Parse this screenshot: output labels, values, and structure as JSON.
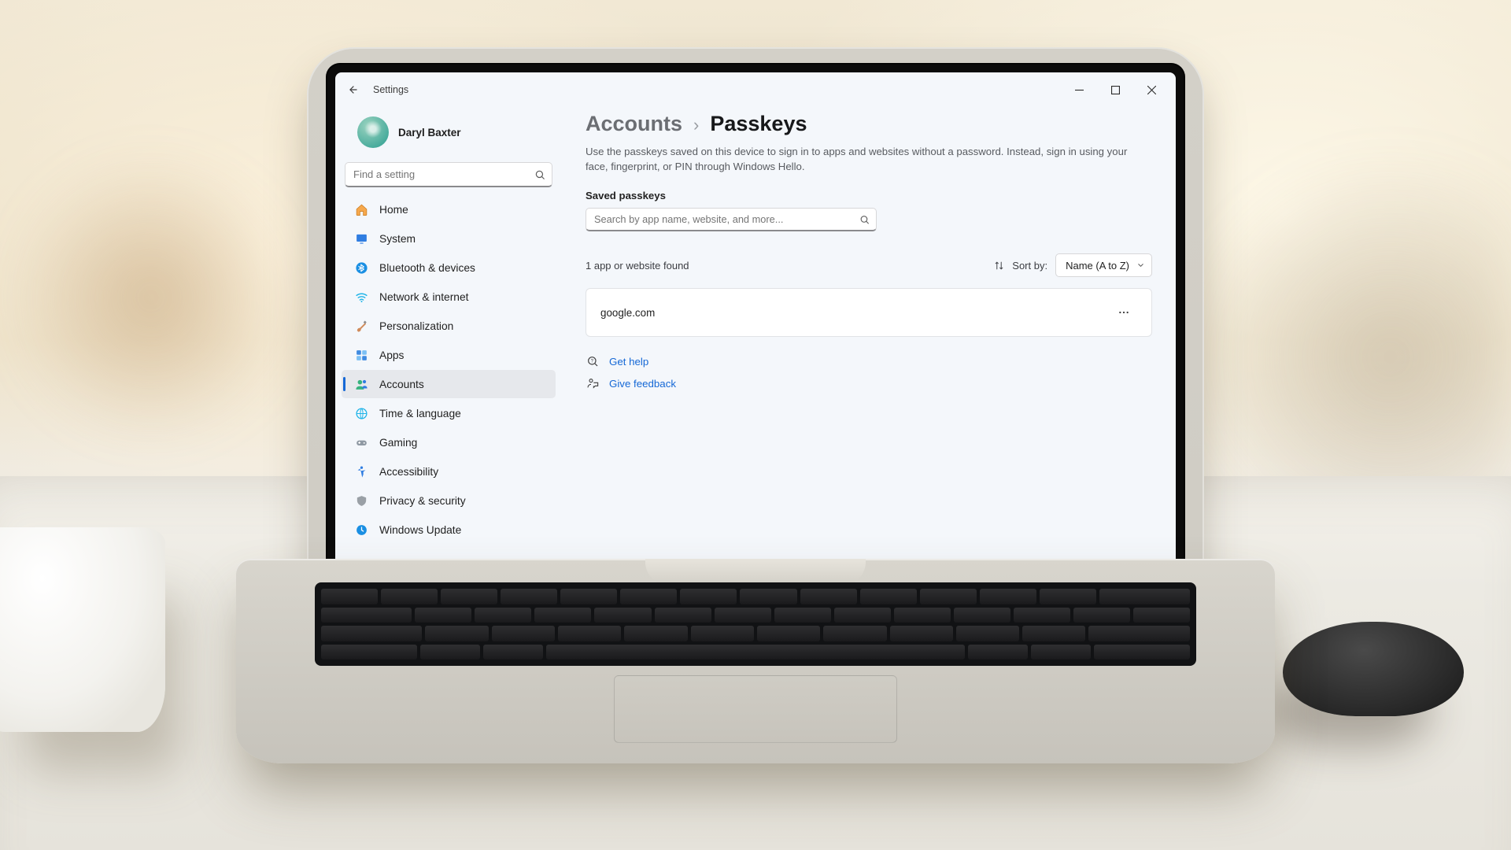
{
  "window": {
    "app_title": "Settings"
  },
  "profile": {
    "display_name": "Daryl Baxter"
  },
  "sidebar": {
    "search_placeholder": "Find a setting",
    "items": [
      {
        "id": "home",
        "label": "Home"
      },
      {
        "id": "system",
        "label": "System"
      },
      {
        "id": "bluetooth",
        "label": "Bluetooth & devices"
      },
      {
        "id": "network",
        "label": "Network & internet"
      },
      {
        "id": "personalization",
        "label": "Personalization"
      },
      {
        "id": "apps",
        "label": "Apps"
      },
      {
        "id": "accounts",
        "label": "Accounts"
      },
      {
        "id": "time",
        "label": "Time & language"
      },
      {
        "id": "gaming",
        "label": "Gaming"
      },
      {
        "id": "accessibility",
        "label": "Accessibility"
      },
      {
        "id": "privacy",
        "label": "Privacy & security"
      },
      {
        "id": "update",
        "label": "Windows Update"
      }
    ],
    "active_id": "accounts"
  },
  "breadcrumb": {
    "parent": "Accounts",
    "current": "Passkeys"
  },
  "page": {
    "description": "Use the passkeys saved on this device to sign in to apps and websites without a password. Instead, sign in using your face, fingerprint, or PIN through Windows Hello.",
    "section_label": "Saved passkeys",
    "search_placeholder": "Search by app name, website, and more...",
    "found_text": "1 app or website found",
    "sort_label": "Sort by:",
    "sort_value": "Name (A to Z)",
    "passkeys": [
      {
        "domain": "google.com"
      }
    ],
    "help": {
      "get_help": "Get help",
      "give_feedback": "Give feedback"
    }
  }
}
